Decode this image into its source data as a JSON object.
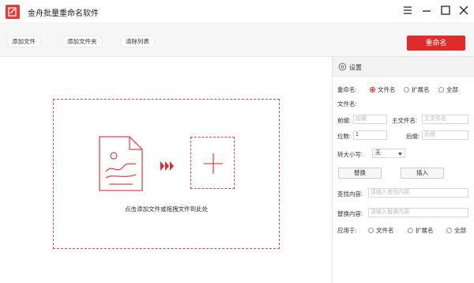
{
  "app": {
    "title": "金舟批量重命名软件"
  },
  "toolbar": {
    "add_file": "添加文件",
    "add_folder": "添加文件夹",
    "clear_list": "清除列表",
    "rename": "重命名"
  },
  "drop_zone": {
    "hint": "点击添加文件或拖拽文件到此处"
  },
  "settings": {
    "title": "设置",
    "rename_label": "重命名:",
    "rename_options": [
      "文件名",
      "扩展名",
      "全部"
    ],
    "rename_selected": "文件名",
    "filename_label": "文件名:",
    "prefix_label": "前缀:",
    "prefix_placeholder": "前缀",
    "main_name_label": "主文件名:",
    "main_name_placeholder": "主文件名",
    "digits_label": "位数:",
    "digits_value": "1",
    "suffix_label": "后缀:",
    "suffix_placeholder": "后缀",
    "case_label": "转大小写:",
    "case_value": "无",
    "replace_button": "替换",
    "insert_button": "插入",
    "find_label": "查找内容:",
    "find_placeholder": "请输入查找内容",
    "replace_label": "替换内容:",
    "replace_placeholder": "请输入替换内容",
    "apply_label": "应用于:",
    "apply_options": [
      "文件名",
      "扩展名",
      "全部"
    ]
  },
  "colors": {
    "accent": "#e02b2b",
    "icon_red": "#d94a4a"
  },
  "icons": [
    "app-logo-icon",
    "menu-icon",
    "minimize-icon",
    "maximize-icon",
    "close-icon",
    "gear-icon",
    "file-image-icon",
    "triple-arrow-icon",
    "plus-icon",
    "caret-down-icon"
  ]
}
